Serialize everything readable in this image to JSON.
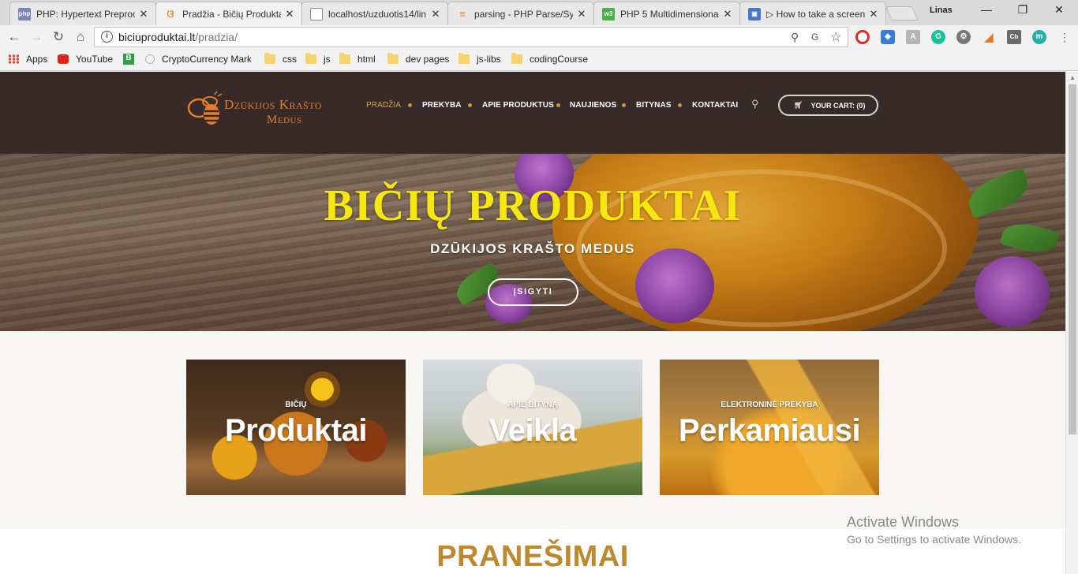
{
  "browser": {
    "tabs": [
      {
        "title": "PHP: Hypertext Preproc",
        "favicon": "php-icon",
        "color": "#7a86b8"
      },
      {
        "title": "Pradžia - Bičių Produkta",
        "favicon": "bee-icon",
        "color": "#e27d2a"
      },
      {
        "title": "localhost/uzduotis14/lin",
        "favicon": "page-icon",
        "color": "#888888"
      },
      {
        "title": "parsing - PHP Parse/Syn",
        "favicon": "stackoverflow-icon",
        "color": "#f48024"
      },
      {
        "title": "PHP 5 Multidimensiona",
        "favicon": "w3schools-icon",
        "color": "#4caf50"
      },
      {
        "title": "▷ How to take a screen",
        "favicon": "screen-icon",
        "color": "#4a76c9"
      }
    ],
    "close_glyph": "✕",
    "user": "Linas",
    "address": {
      "host": "biciuproduktai.lt",
      "path": "/pradzia/"
    },
    "bookmarks": [
      {
        "label": "Apps",
        "icon": "apps-grid-icon"
      },
      {
        "label": "YouTube",
        "icon": "youtube-icon"
      },
      {
        "label": "",
        "icon": "bitcoin-b-icon"
      },
      {
        "label": "CryptoCurrency Mark",
        "icon": "crypto-icon"
      },
      {
        "label": "css",
        "icon": "folder-icon"
      },
      {
        "label": "js",
        "icon": "folder-icon"
      },
      {
        "label": "html",
        "icon": "folder-icon"
      },
      {
        "label": "dev pages",
        "icon": "folder-icon"
      },
      {
        "label": "js-libs",
        "icon": "folder-icon"
      },
      {
        "label": "codingCourse",
        "icon": "folder-icon"
      }
    ]
  },
  "site": {
    "logo": {
      "line1": "Dzūkijos Krašto",
      "line2": "Medus"
    },
    "nav": [
      "PRADŽIA",
      "PREKYBA",
      "APIE PRODUKTUS",
      "NAUJIENOS",
      "BITYNAS",
      "KONTAKTAI"
    ],
    "cart_label": "YOUR CART: (0)",
    "hero": {
      "title": "BIČIŲ PRODUKTAI",
      "subtitle": "DZŪKIJOS KRAŠTO MEDUS",
      "button": "ĮSIGYTI"
    },
    "cards": [
      {
        "small": "BIČIŲ",
        "big": "Produktai"
      },
      {
        "small": "APIE BITYNĄ",
        "big": "Veikla"
      },
      {
        "small": "ELEKTRONINĖ PREKYBA",
        "big": "Perkamiausi"
      }
    ],
    "section_title": "PRANEŠIMAI"
  },
  "overlay": {
    "line1": "Activate Windows",
    "line2": "Go to Settings to activate Windows."
  },
  "colors": {
    "header_bg": "#372a29",
    "accent_gold": "#c0882d",
    "hero_title": "#f5e70f",
    "logo_orange": "#e27d2a"
  }
}
